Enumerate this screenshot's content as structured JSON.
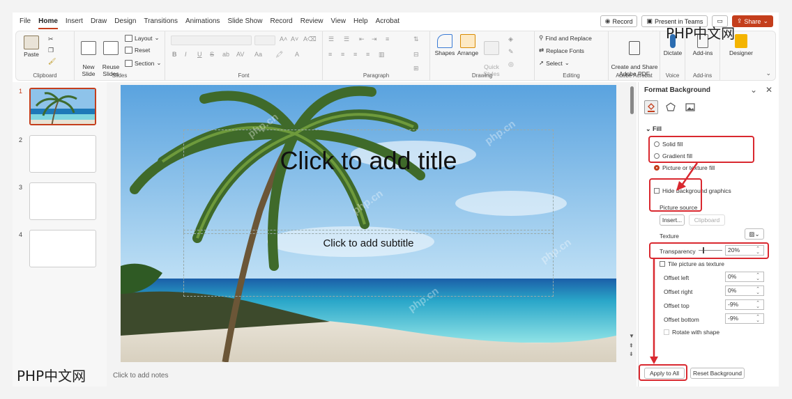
{
  "tabs": [
    "File",
    "Home",
    "Insert",
    "Draw",
    "Design",
    "Transitions",
    "Animations",
    "Slide Show",
    "Record",
    "Review",
    "View",
    "Help",
    "Acrobat"
  ],
  "active_tab": "Home",
  "top_right": {
    "record": "Record",
    "present": "Present in Teams",
    "share": "Share"
  },
  "ribbon": {
    "clipboard": {
      "paste": "Paste",
      "label": "Clipboard"
    },
    "slides": {
      "new_slide": "New\nSlide",
      "reuse": "Reuse\nSlides",
      "layout": "Layout",
      "reset": "Reset",
      "section": "Section",
      "label": "Slides"
    },
    "font": {
      "label": "Font",
      "bold": "B",
      "italic": "I",
      "underline": "U",
      "strike": "S",
      "spacing": "AV",
      "case": "Aa"
    },
    "paragraph": {
      "label": "Paragraph"
    },
    "drawing": {
      "shapes": "Shapes",
      "arrange": "Arrange",
      "quick_styles": "Quick\nStyles",
      "label": "Drawing"
    },
    "editing": {
      "find_replace": "Find and Replace",
      "replace_fonts": "Replace Fonts",
      "select": "Select",
      "label": "Editing"
    },
    "acrobat": {
      "create": "Create and Share\nAdobe PDF",
      "label": "Adobe Acrobat"
    },
    "voice": {
      "dictate": "Dictate",
      "label": "Voice"
    },
    "addins": {
      "addins": "Add-ins",
      "label": "Add-ins"
    },
    "designer": {
      "designer": "Designer"
    }
  },
  "thumbnails": [
    "1",
    "2",
    "3",
    "4"
  ],
  "slide": {
    "title_placeholder": "Click to add title",
    "subtitle_placeholder": "Click to add subtitle"
  },
  "notes_placeholder": "Click to add notes",
  "pane": {
    "title": "Format Background",
    "fill_section": "Fill",
    "solid_fill": "Solid fill",
    "gradient_fill": "Gradient fill",
    "picture_fill": "Picture or texture fill",
    "hide_bg": "Hide background graphics",
    "picture_source": "Picture source",
    "insert": "Insert...",
    "clipboard": "Clipboard",
    "texture": "Texture",
    "transparency": "Transparency",
    "transparency_value": "20%",
    "tile": "Tile picture as texture",
    "offset_left": "Offset left",
    "offset_left_value": "0%",
    "offset_right": "Offset right",
    "offset_right_value": "0%",
    "offset_top": "Offset top",
    "offset_top_value": "-9%",
    "offset_bottom": "Offset bottom",
    "offset_bottom_value": "-9%",
    "rotate": "Rotate with shape",
    "apply_all": "Apply to All",
    "reset_bg": "Reset Background"
  },
  "watermarks": {
    "brand": "PHP中文网",
    "site": "php.cn"
  },
  "colors": {
    "accent": "#c43e1c",
    "highlight": "#d9282f"
  }
}
